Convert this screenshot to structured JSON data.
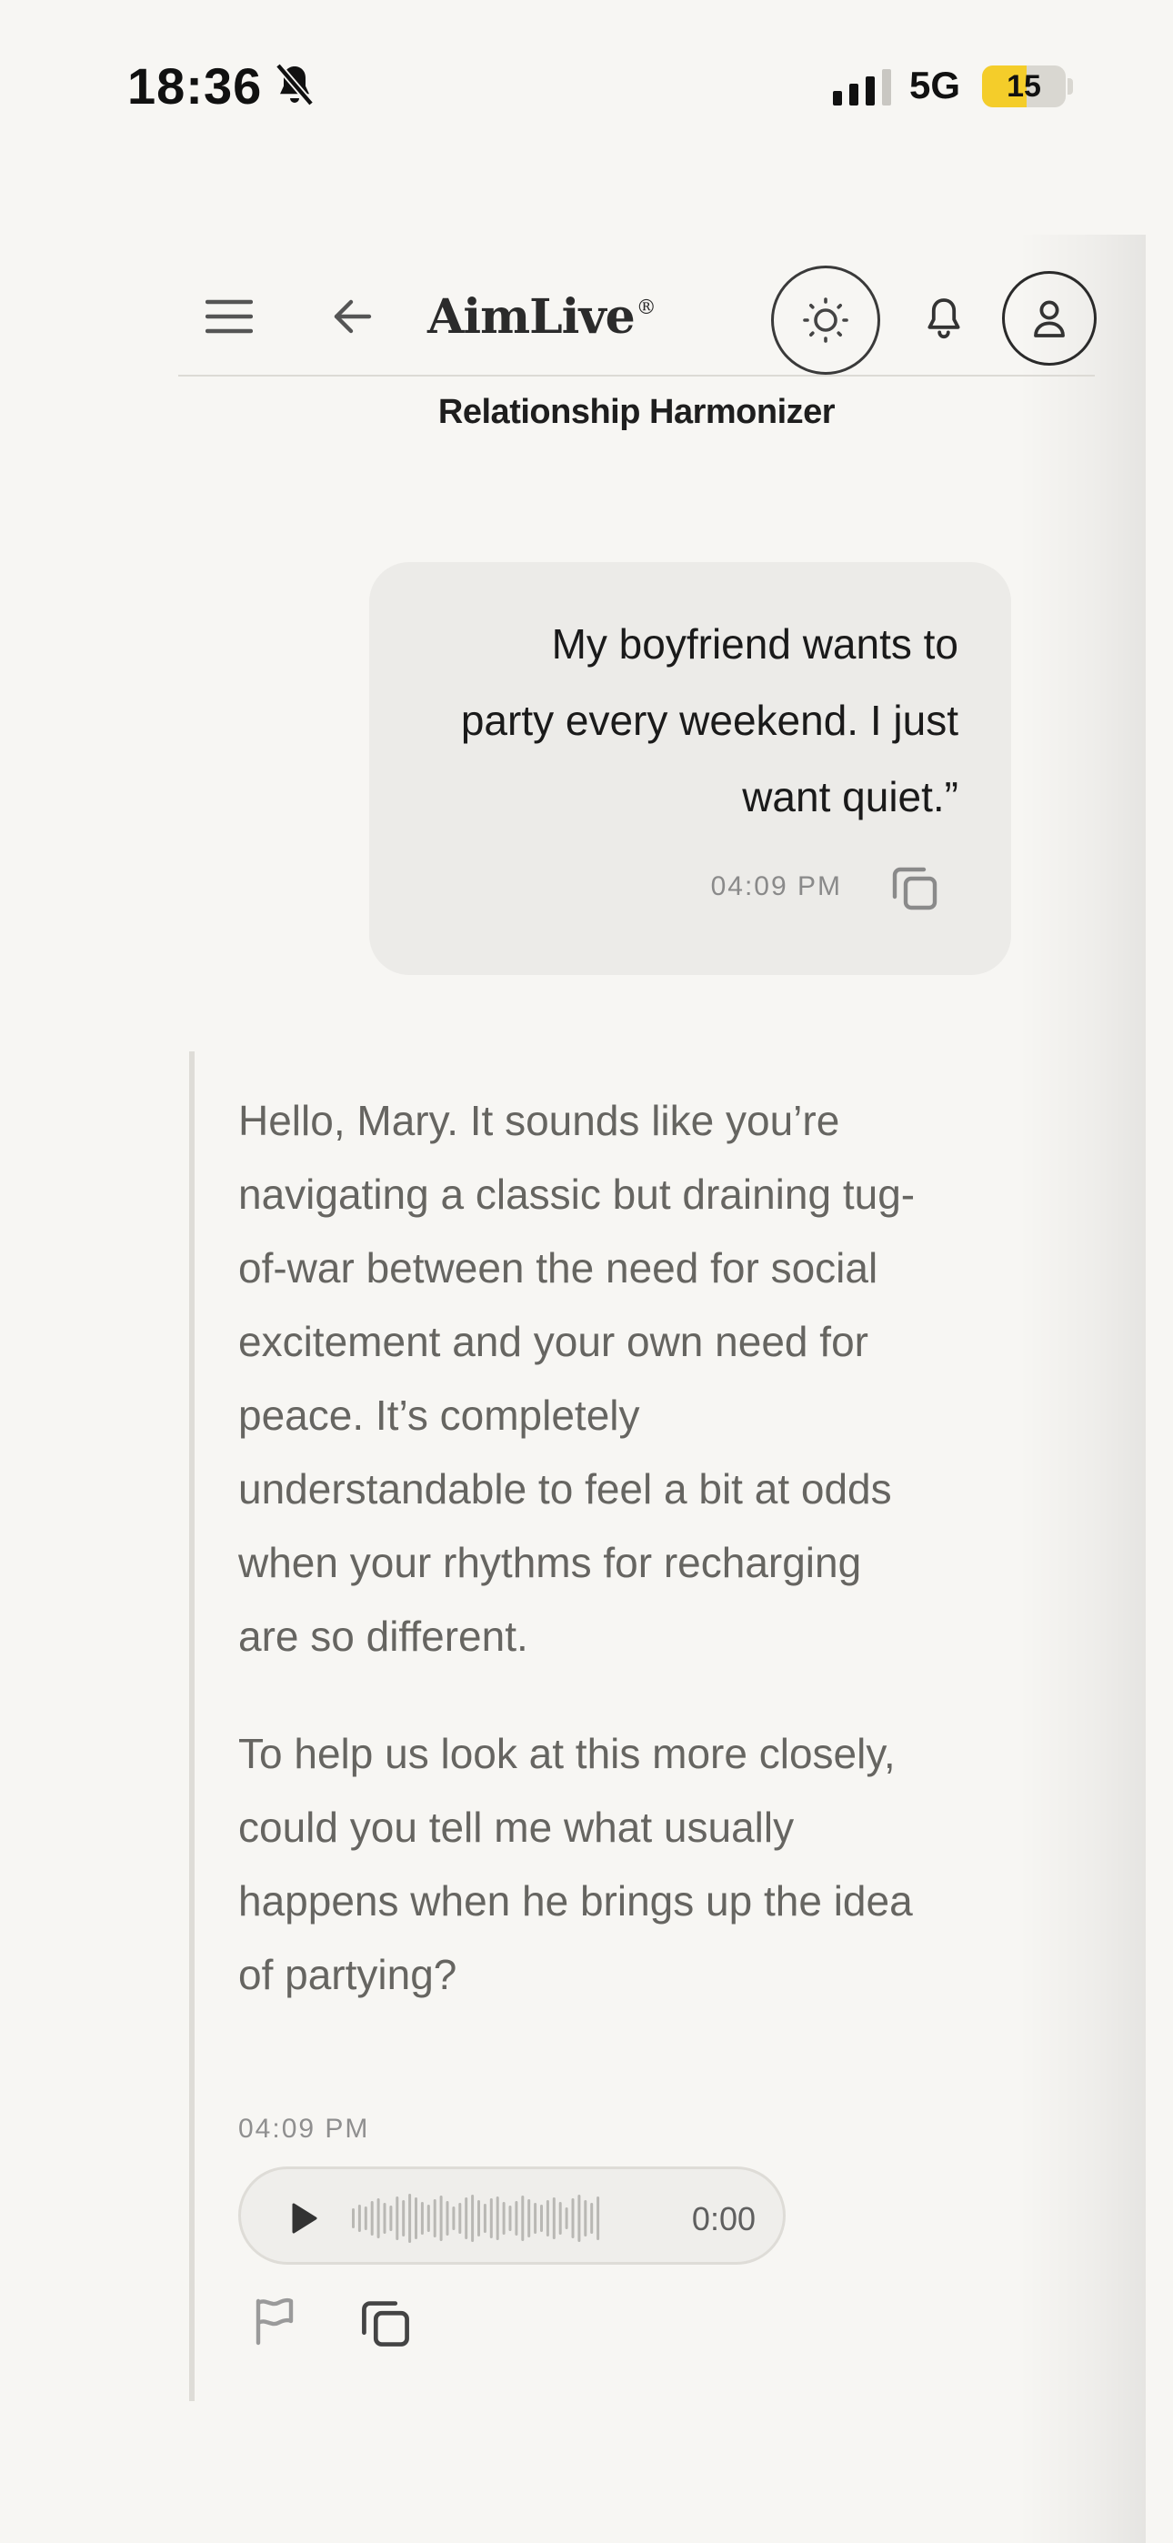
{
  "status_bar": {
    "time": "18:36",
    "network": "5G",
    "battery": "15",
    "battery_level": 0.15
  },
  "header": {
    "brand": "AimLive",
    "brand_mark": "®",
    "subtitle": "Relationship Harmonizer",
    "icons": {
      "menu": "menu-icon",
      "back": "arrow-left-icon",
      "theme": "sun-icon",
      "notifications": "bell-icon",
      "profile": "user-icon"
    }
  },
  "conversation": {
    "user_message": {
      "text": "My boyfriend wants to party every weekend. I just want quiet.”",
      "time": "04:09 PM"
    },
    "assistant_message": {
      "paragraphs": [
        "Hello, Mary. It sounds like you’re navigating a classic but draining tug-of-war between the need for social excitement and your own need for peace. It’s completely understandable to feel a bit at odds when your rhythms for recharging are so different.",
        "To help us look at this more closely, could you tell me what usually happens when he brings up the idea of partying?"
      ],
      "time": "04:09 PM",
      "audio": {
        "duration": "0:00",
        "progress": 0
      }
    }
  },
  "colors": {
    "background": "#f7f6f3",
    "bubble": "#ecebe8",
    "battery_accent": "#f4cd2a",
    "muted_text": "#666561"
  }
}
